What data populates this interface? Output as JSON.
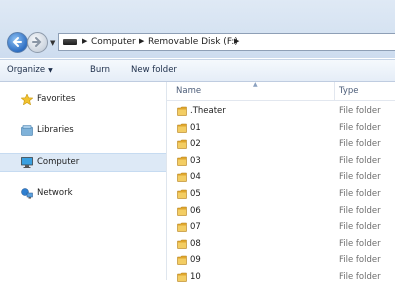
{
  "address_bar": {
    "crumbs": [
      "Computer",
      "Removable Disk (F:)"
    ]
  },
  "toolbar": {
    "organize_label": "Organize",
    "burn_label": "Burn",
    "new_folder_label": "New folder"
  },
  "nav_pane": {
    "items": [
      {
        "label": "Favorites",
        "icon": "star-icon"
      },
      {
        "label": "Libraries",
        "icon": "libraries-icon"
      },
      {
        "label": "Computer",
        "icon": "computer-icon",
        "selected": true
      },
      {
        "label": "Network",
        "icon": "network-icon"
      }
    ]
  },
  "file_list": {
    "columns": [
      "Name",
      "Type"
    ],
    "rows": [
      {
        "name": ".Theater",
        "type": "File folder"
      },
      {
        "name": "01",
        "type": "File folder"
      },
      {
        "name": "02",
        "type": "File folder"
      },
      {
        "name": "03",
        "type": "File folder"
      },
      {
        "name": "04",
        "type": "File folder"
      },
      {
        "name": "05",
        "type": "File folder"
      },
      {
        "name": "06",
        "type": "File folder"
      },
      {
        "name": "07",
        "type": "File folder"
      },
      {
        "name": "08",
        "type": "File folder"
      },
      {
        "name": "09",
        "type": "File folder"
      },
      {
        "name": "10",
        "type": "File folder"
      }
    ]
  },
  "colors": {
    "accent": "#dde9f6",
    "folder": "#e8b43c",
    "header_text": "#4b5c78"
  }
}
